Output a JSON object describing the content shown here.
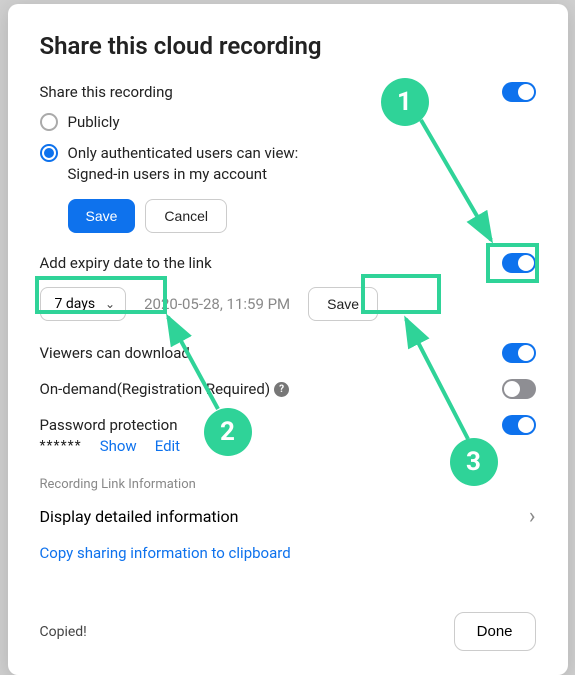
{
  "title": "Share this cloud recording",
  "share_section_label": "Share this recording",
  "radio_publicly": "Publicly",
  "radio_auth_line1": "Only authenticated users can view:",
  "radio_auth_line2": "Signed-in users in my account",
  "save_label": "Save",
  "cancel_label": "Cancel",
  "expiry_label": "Add expiry date to the link",
  "expiry_select_value": "7 days",
  "expiry_date": "2020-05-28, 11:59 PM",
  "expiry_save": "Save",
  "viewers_download": "Viewers can download",
  "on_demand": "On-demand(Registration Required)",
  "password_protection": "Password protection",
  "password_mask": "******",
  "show_label": "Show",
  "edit_label": "Edit",
  "link_info_heading": "Recording Link Information",
  "display_detailed": "Display detailed information",
  "copy_link": "Copy sharing information to clipboard",
  "copied": "Copied!",
  "done": "Done",
  "annotations": {
    "one": "1",
    "two": "2",
    "three": "3"
  }
}
